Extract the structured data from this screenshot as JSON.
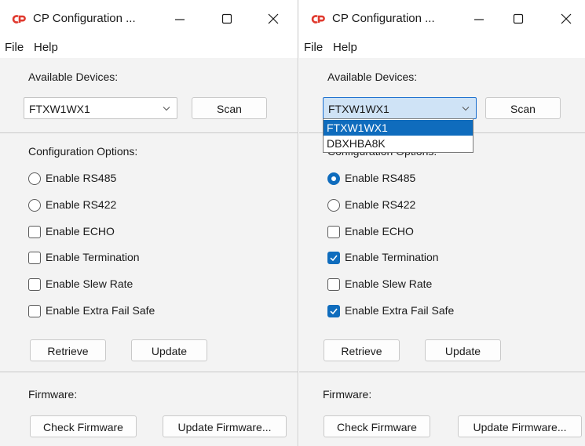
{
  "windows": [
    {
      "title": "CP Configuration ...",
      "menu": [
        "File",
        "Help"
      ],
      "available_label": "Available Devices:",
      "device_selected": "FTXW1WX1",
      "scan_label": "Scan",
      "config_label": "Configuration Options:",
      "options": [
        {
          "type": "radio",
          "label": "Enable RS485",
          "checked": false
        },
        {
          "type": "radio",
          "label": "Enable RS422",
          "checked": false
        },
        {
          "type": "checkbox",
          "label": "Enable ECHO",
          "checked": false
        },
        {
          "type": "checkbox",
          "label": "Enable Termination",
          "checked": false
        },
        {
          "type": "checkbox",
          "label": "Enable Slew Rate",
          "checked": false
        },
        {
          "type": "checkbox",
          "label": "Enable Extra Fail Safe",
          "checked": false
        }
      ],
      "retrieve_label": "Retrieve",
      "update_label": "Update",
      "firmware_label": "Firmware:",
      "check_firmware_label": "Check Firmware",
      "update_firmware_label": "Update Firmware..."
    },
    {
      "title": "CP Configuration ...",
      "menu": [
        "File",
        "Help"
      ],
      "available_label": "Available Devices:",
      "device_selected": "FTXW1WX1",
      "dropdown_open": true,
      "device_options": [
        "FTXW1WX1",
        "DBXHBA8K"
      ],
      "scan_label": "Scan",
      "config_label": "Configuration Options:",
      "options": [
        {
          "type": "radio",
          "label": "Enable RS485",
          "checked": true
        },
        {
          "type": "radio",
          "label": "Enable RS422",
          "checked": false
        },
        {
          "type": "checkbox",
          "label": "Enable ECHO",
          "checked": false
        },
        {
          "type": "checkbox",
          "label": "Enable Termination",
          "checked": true
        },
        {
          "type": "checkbox",
          "label": "Enable Slew Rate",
          "checked": false
        },
        {
          "type": "checkbox",
          "label": "Enable Extra Fail Safe",
          "checked": true
        }
      ],
      "retrieve_label": "Retrieve",
      "update_label": "Update",
      "firmware_label": "Firmware:",
      "check_firmware_label": "Check Firmware",
      "update_firmware_label": "Update Firmware..."
    }
  ],
  "colors": {
    "accent": "#0f6cbd",
    "app_icon": "#e03a2f",
    "window_bg": "#f3f3f3",
    "titlebar_bg": "#ffffff"
  },
  "icons": {
    "app": "cp-logo-icon",
    "minimize": "minimize-icon",
    "maximize": "maximize-icon",
    "close": "close-icon",
    "dropdown": "chevron-down-icon",
    "check": "checkmark-icon"
  }
}
